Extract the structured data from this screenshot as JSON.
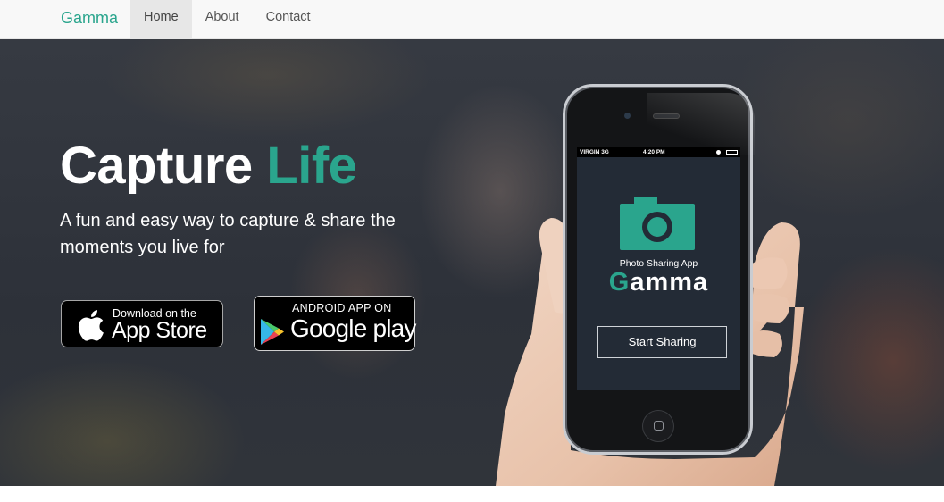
{
  "navbar": {
    "brand": "Gamma",
    "items": [
      {
        "label": "Home",
        "active": true
      },
      {
        "label": "About",
        "active": false
      },
      {
        "label": "Contact",
        "active": false
      }
    ]
  },
  "hero": {
    "title_main": "Capture",
    "title_accent": "Life",
    "subtitle": "A fun and easy way to capture & share the moments you live for",
    "accent_color": "#2aa58d"
  },
  "badges": {
    "appstore": {
      "small": "Download on the",
      "big": "App Store",
      "icon": "apple-icon"
    },
    "googleplay": {
      "small": "ANDROID APP ON",
      "big": "Google play",
      "icon": "google-play-icon"
    }
  },
  "phone": {
    "status_carrier": "VIRGIN  3G",
    "status_time": "4:20 PM",
    "app_tagline": "Photo Sharing App",
    "app_name_first": "G",
    "app_name_rest": "amma",
    "start_button": "Start Sharing",
    "icon": "camera-icon"
  }
}
